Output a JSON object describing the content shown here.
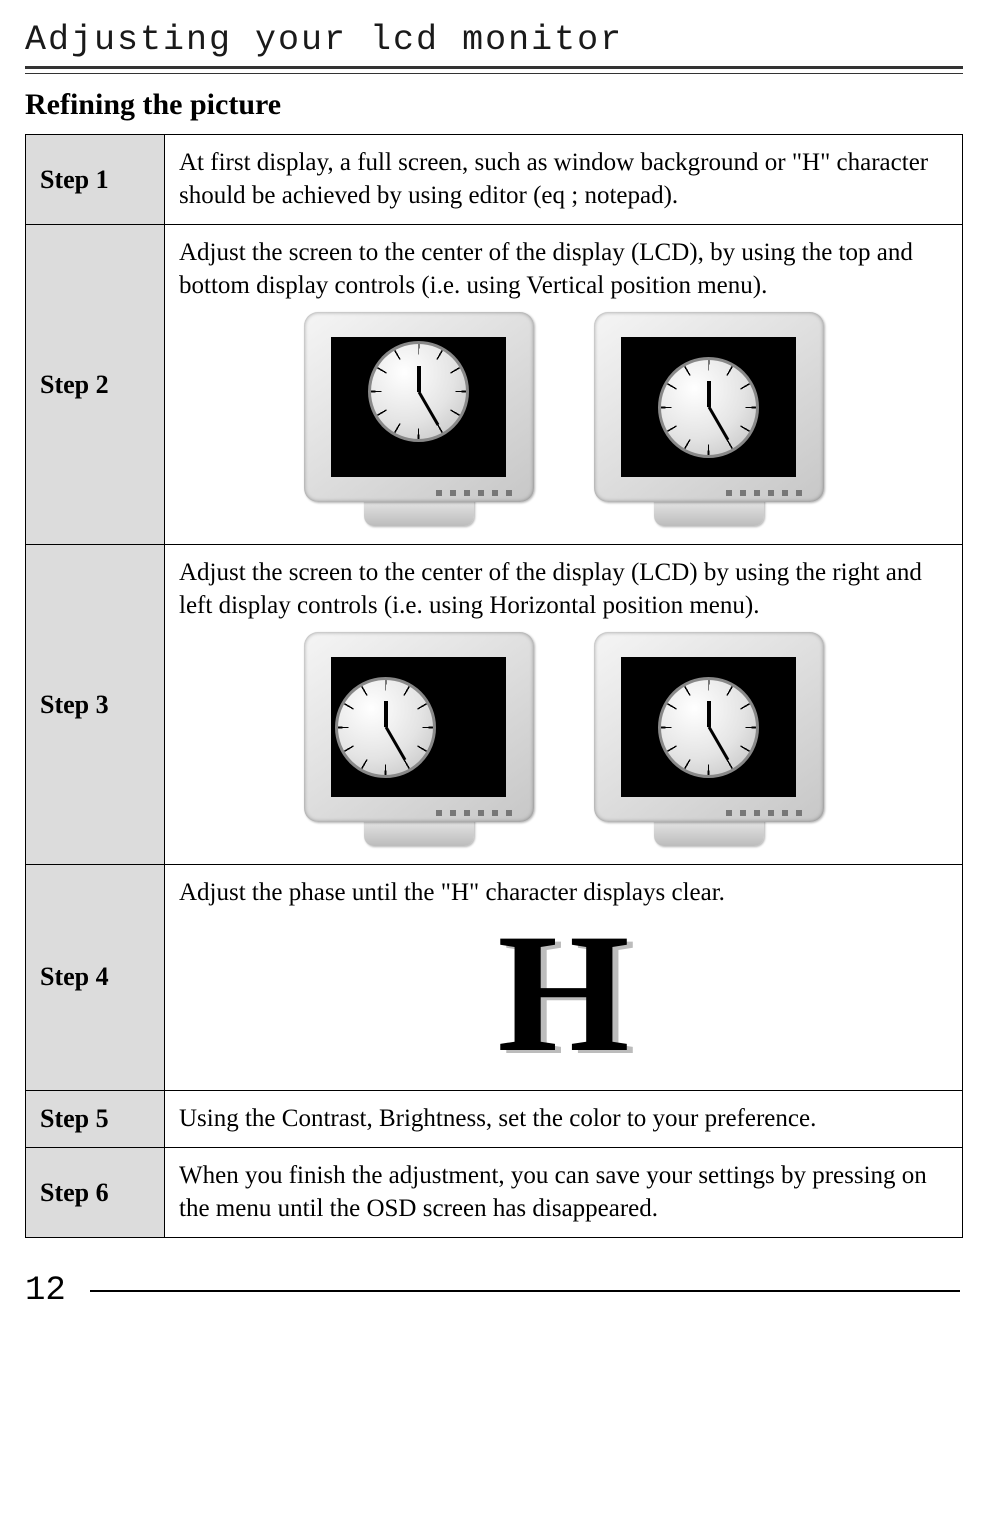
{
  "title": "Adjusting your lcd monitor",
  "section_heading": "Refining the picture",
  "steps": [
    {
      "label": "Step 1",
      "text": "At first display, a full screen, such as window background or \"H\" character should be achieved by using editor (eq ; notepad)."
    },
    {
      "label": "Step 2",
      "text": "Adjust the screen to the center of the display (LCD), by using the top and bottom display controls (i.e. using Vertical position menu)."
    },
    {
      "label": "Step 3",
      "text": "Adjust the screen to the center of the display (LCD) by using the right and left display controls (i.e. using Horizontal position menu)."
    },
    {
      "label": "Step 4",
      "text": "Adjust the phase until the \"H\" character displays clear.",
      "glyph": "H"
    },
    {
      "label": "Step 5",
      "text": "Using the Contrast, Brightness, set the color to your preference."
    },
    {
      "label": "Step 6",
      "text": "When you finish the adjustment, you can save your settings by pressing on the menu until the OSD screen has disappeared."
    }
  ],
  "page_number": "12"
}
